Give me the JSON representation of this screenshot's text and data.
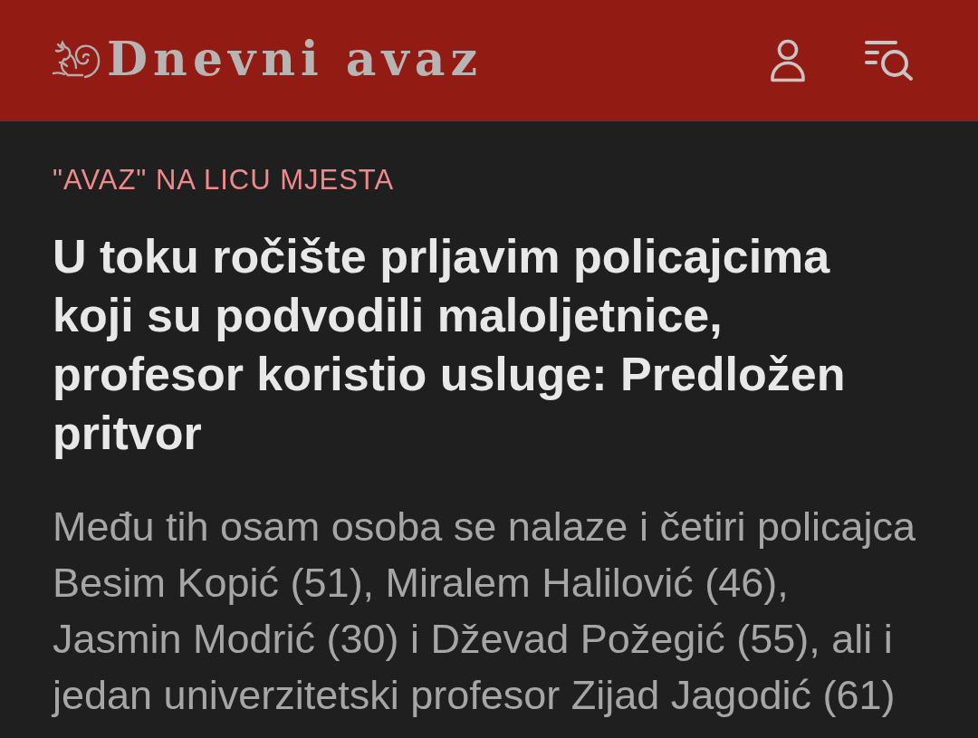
{
  "header": {
    "logo_text": "Dnevni avaz"
  },
  "article": {
    "category": "\"AVAZ\" NA LICU MJESTA",
    "headline": "U toku ročište prljavim policajcima koji su podvodili maloljetnice, profesor koristio usluge: Predložen pritvor",
    "lead": "Među tih osam osoba se nalaze i četiri policajca Besim Kopić (51), Miralem Halilović (46), Jasmin Modrić (30) i Dževad Požegić (55), ali i jedan univerzitetski profesor Zijad Jagodić (61)"
  }
}
